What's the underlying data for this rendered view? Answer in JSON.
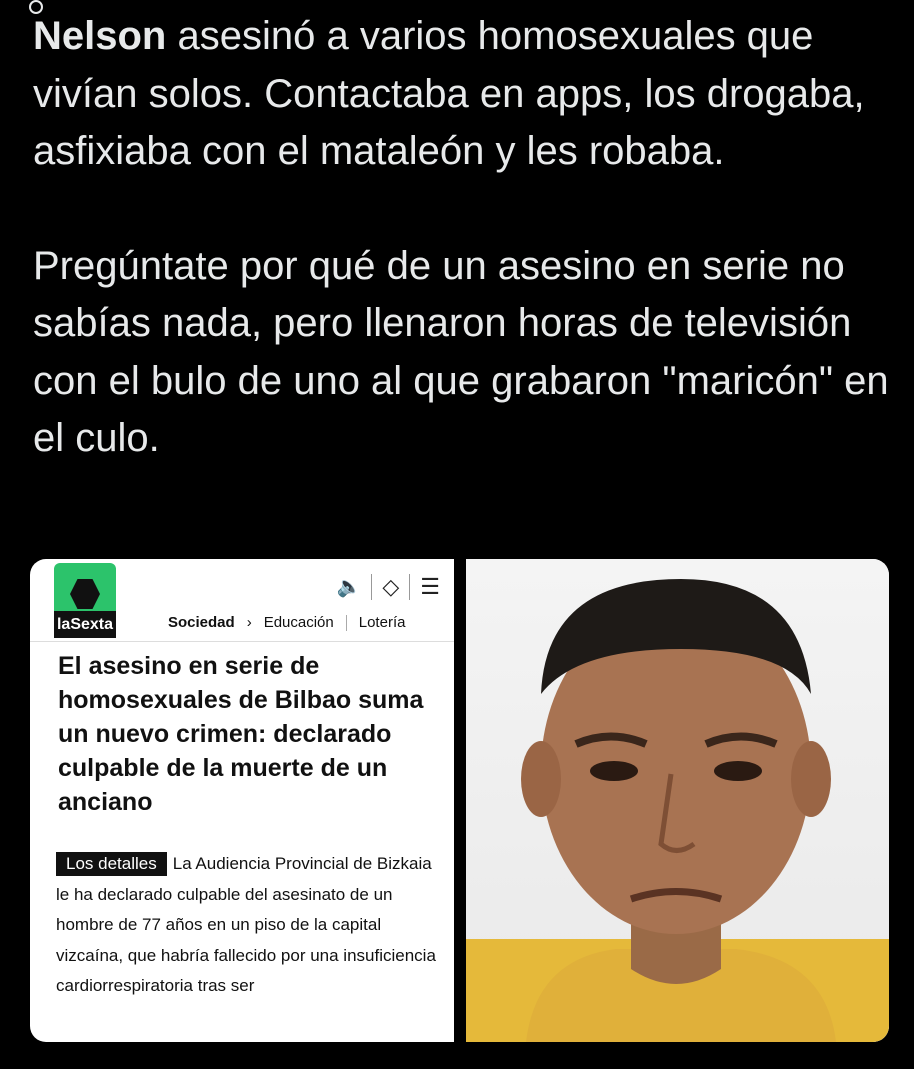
{
  "tweet": {
    "author": "Nelson",
    "line1_rest": "asesinó a varios homosexuales que vivían solos. Contactaba en apps, los drogaba, asfixiaba con el mataleón y les robaba.",
    "paragraph2": "Pregúntate por qué de un asesino en serie no sabías nada, pero llenaron horas de televisión con el bulo de uno al que grabaron \"maricón\" en el culo."
  },
  "article": {
    "logo_label": "laSexta",
    "nav": [
      "Sociedad",
      "Educación",
      "Lotería"
    ],
    "headline": "El asesino en serie de homosexuales de Bilbao suma un nuevo crimen: declarado culpable de la muerte de un anciano",
    "details_tag": "Los detalles",
    "body": "La Audiencia Provincial de Bizkaia le ha declarado culpable del asesinato de un hombre de 77 años en un piso de la capital vizcaína, que habría fallecido por una insuficiencia cardiorrespiratoria tras ser"
  },
  "icons": [
    "speaker-icon",
    "share-icon",
    "menu-icon",
    "chevron-right-icon"
  ],
  "colors": {
    "background": "#000000",
    "text": "#e7e9ea",
    "logo_green": "#2cc36b",
    "speaker_red": "#e0443a"
  }
}
